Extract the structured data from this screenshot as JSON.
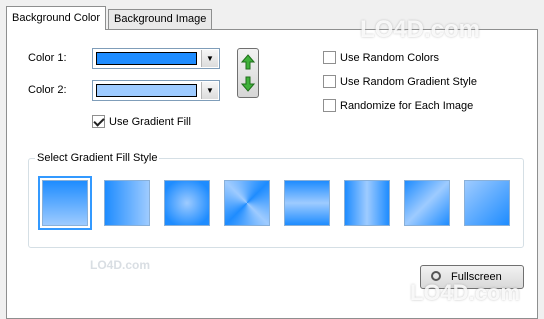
{
  "tabs": [
    {
      "label": "Background Color"
    },
    {
      "label": "Background Image"
    }
  ],
  "color1": {
    "label": "Color 1:",
    "value": "#1e8cff"
  },
  "color2": {
    "label": "Color 2:",
    "value": "#9ecbff"
  },
  "gradient_fill": {
    "label": "Use Gradient Fill",
    "checked": true
  },
  "options": [
    {
      "label": "Use Random Colors",
      "checked": false
    },
    {
      "label": "Use Random Gradient Style",
      "checked": false
    },
    {
      "label": "Randomize for Each Image",
      "checked": false
    }
  ],
  "gradient_group": {
    "title": "Select Gradient Fill Style",
    "styles": [
      "vertical",
      "horizontal",
      "radial",
      "diamond",
      "horizontal-center",
      "vertical-center",
      "diagonal-cross",
      "diagonal"
    ],
    "selected_index": 0
  },
  "fullscreen_label": "Fullscreen",
  "watermarks": {
    "logo": "LO4D.com",
    "small": "LO4D.com"
  },
  "colors": {
    "accent": "#1e8cff",
    "light": "#9ecbff",
    "selection": "#3399ff"
  },
  "icons": {
    "swap_up": "green-arrow-up-icon",
    "swap_down": "green-arrow-down-icon",
    "magnifier": "magnifier-icon"
  }
}
